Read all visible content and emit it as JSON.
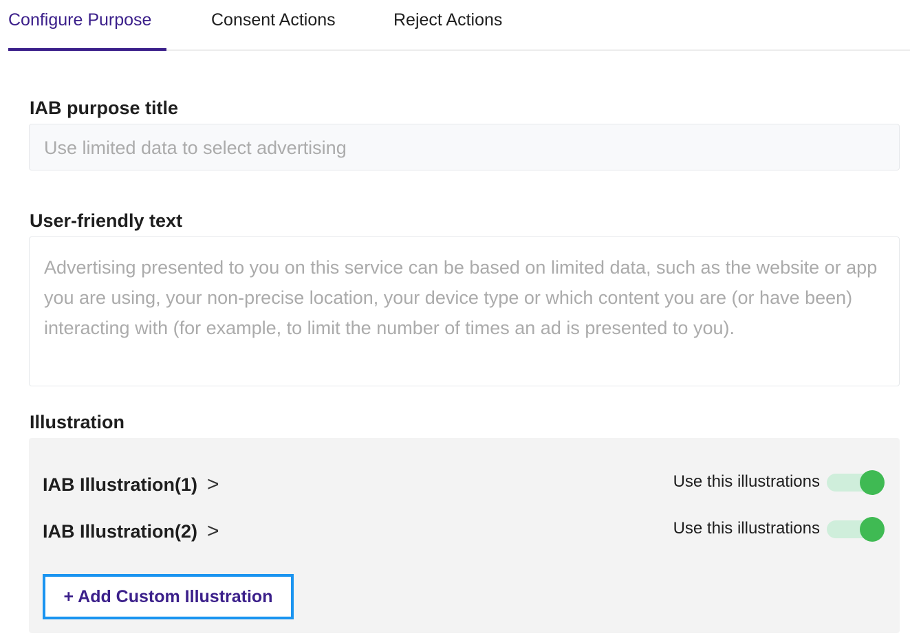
{
  "tabs": [
    {
      "label": "Configure Purpose",
      "active": true
    },
    {
      "label": "Consent Actions",
      "active": false
    },
    {
      "label": "Reject Actions",
      "active": false
    }
  ],
  "iab_title": {
    "label": "IAB purpose title",
    "placeholder": "Use limited data to select advertising"
  },
  "user_text": {
    "label": "User-friendly text",
    "placeholder": "Advertising presented to you on this service can be based on limited data, such as the website or app you are using, your non-precise location, your device type or which content you are (or have been) interacting with (for example, to limit the number of times an ad is presented to you)."
  },
  "illustration": {
    "label": "Illustration",
    "items": [
      {
        "name": "IAB Illustration(1)",
        "toggle_label": "Use this illustrations",
        "enabled": true
      },
      {
        "name": "IAB Illustration(2)",
        "toggle_label": "Use this illustrations",
        "enabled": true
      }
    ],
    "add_button": "+ Add Custom Illustration"
  },
  "icons": {
    "chevron": "chevron-right-icon"
  },
  "colors": {
    "accent": "#3b1f8a",
    "toggle_on": "#3fba53",
    "toggle_track": "#cfeedb",
    "focus_border": "#1a94f0"
  }
}
